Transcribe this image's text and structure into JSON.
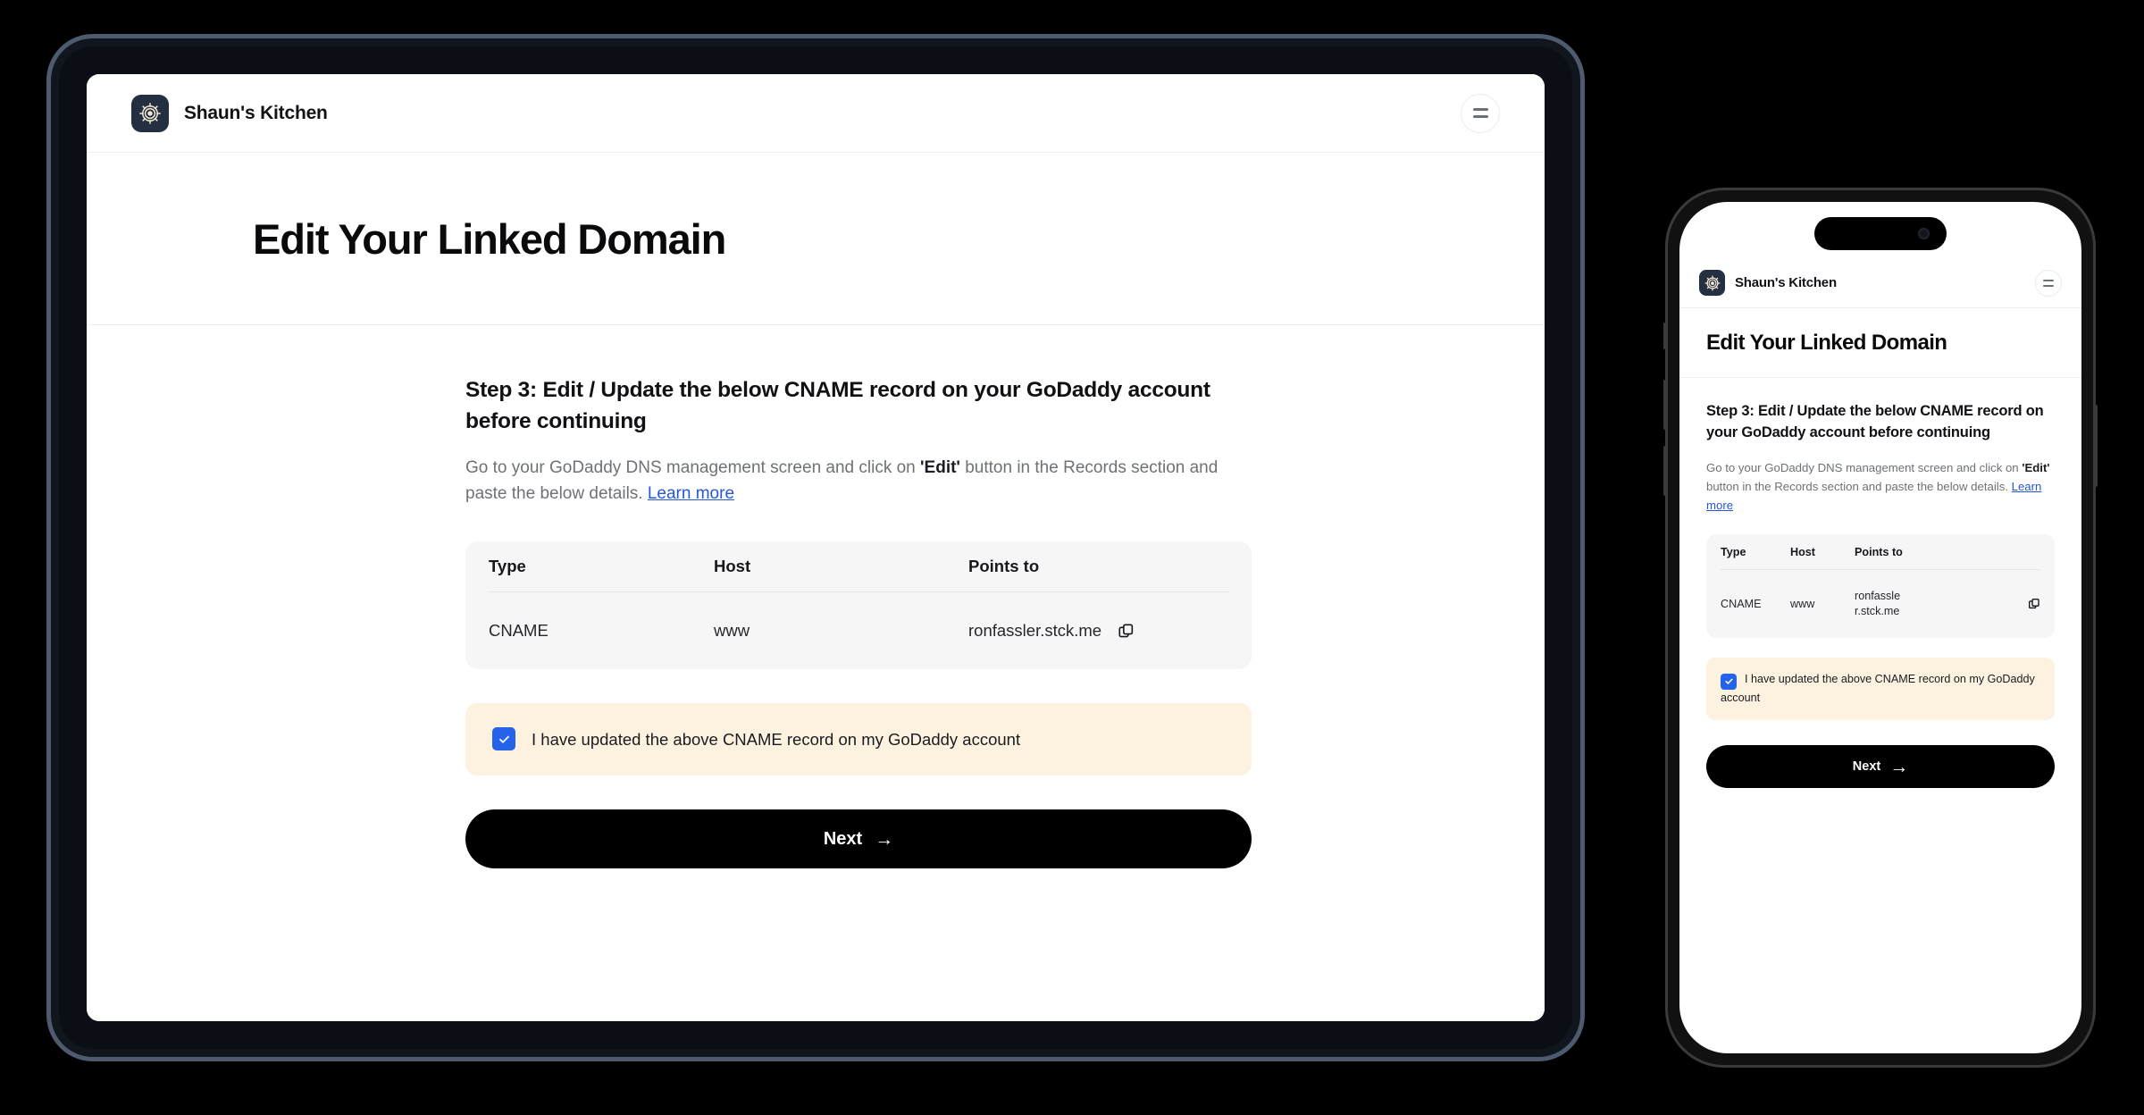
{
  "brand": {
    "name": "Shaun's Kitchen",
    "logo_icon": "ship-wheel-icon",
    "logo_bg": "#242f42",
    "logo_fg": "#f2e8d2"
  },
  "header": {
    "menu_icon": "hamburger-menu-icon"
  },
  "page": {
    "title": "Edit Your Linked Domain"
  },
  "step": {
    "heading": "Step 3: Edit / Update the below CNAME record on your GoDaddy account before continuing",
    "desc_part1": "Go to your GoDaddy DNS management screen and click on ",
    "desc_bold": "'Edit'",
    "desc_part2": " button in the Records section and paste the below details. ",
    "link_label": "Learn more"
  },
  "dns_table": {
    "columns": [
      "Type",
      "Host",
      "Points to"
    ],
    "rows": [
      {
        "type": "CNAME",
        "host": "www",
        "points_to": "ronfassler.stck.me"
      }
    ],
    "copy_icon": "copy-icon"
  },
  "confirm": {
    "label": "I have updated the above CNAME record on my GoDaddy account",
    "checked": true,
    "check_icon": "checkmark-icon",
    "accent": "#2563eb",
    "background": "#fdf1e0"
  },
  "actions": {
    "next_label": "Next",
    "next_arrow": "→",
    "next_bg": "#000000"
  },
  "devices": {
    "tablet": {
      "frame_color": "#0b0e14",
      "outline_color": "#4e5a6e"
    },
    "phone": {
      "frame_color": "#111111",
      "outline_color": "#3a3a3c"
    }
  },
  "colors": {
    "link": "#2557d6",
    "table_bg": "#f6f6f7",
    "muted_text": "#6e7178"
  }
}
